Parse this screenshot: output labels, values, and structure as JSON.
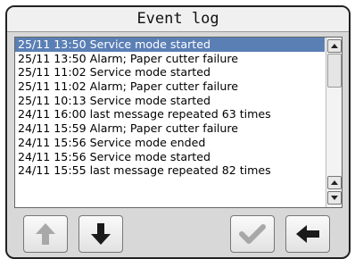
{
  "window": {
    "title": "Event log"
  },
  "log": {
    "entries": [
      "25/11 13:50 Service mode started",
      "25/11 13:50 Alarm; Paper cutter failure",
      "25/11 11:02 Service mode started",
      "25/11 11:02 Alarm; Paper cutter failure",
      "25/11 10:13 Service mode started",
      "24/11 16:00 last message repeated 63 times",
      "24/11 15:59 Alarm; Paper cutter failure",
      "24/11 15:56 Service mode ended",
      "24/11 15:56 Service mode started",
      "24/11 15:55 last message repeated 82 times"
    ],
    "selected_index": 0
  },
  "toolbar": {
    "buttons": [
      {
        "icon": "arrow-up-icon",
        "enabled": false
      },
      {
        "icon": "arrow-down-icon",
        "enabled": true
      },
      {
        "icon": "checkmark-icon",
        "enabled": false
      },
      {
        "icon": "arrow-left-icon",
        "enabled": true
      }
    ]
  },
  "colors": {
    "selection": "#5a7fb5",
    "enabled_icon": "#1a1a1a",
    "disabled_icon": "#a8a8a8"
  }
}
